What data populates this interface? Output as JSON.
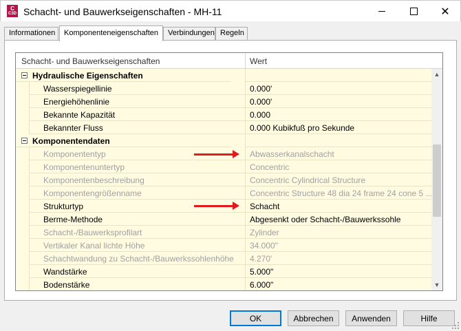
{
  "window": {
    "title": "Schacht- und Bauwerkseigenschaften - MH-11",
    "app_icon": {
      "letter": "C",
      "sub": "C3D",
      "color": "#b3154b"
    },
    "controls": {
      "minimize": "minimize-icon",
      "maximize": "maximize-icon",
      "close": "✕"
    }
  },
  "tabs": [
    {
      "label": "Informationen",
      "active": false
    },
    {
      "label": "Komponenteneigenschaften",
      "active": true
    },
    {
      "label": "Verbindungen",
      "active": false
    },
    {
      "label": "Regeln",
      "active": false
    }
  ],
  "grid": {
    "header": {
      "property": "Schacht- und Bauwerkseigenschaften",
      "value": "Wert"
    },
    "groups": [
      {
        "label": "Hydraulische Eigenschaften",
        "rows": [
          {
            "property": "Wasserspiegellinie",
            "value": "0.000'",
            "enabled": true
          },
          {
            "property": "Energiehöhenlinie",
            "value": "0.000'",
            "enabled": true
          },
          {
            "property": "Bekannte Kapazität",
            "value": "0.000",
            "enabled": true
          },
          {
            "property": "Bekannter Fluss",
            "value": "0.000 Kubikfuß pro Sekunde",
            "enabled": true
          }
        ]
      },
      {
        "label": "Komponentendaten",
        "rows": [
          {
            "property": "Komponententyp",
            "value": "Abwasserkanalschacht",
            "enabled": false
          },
          {
            "property": "Komponentenuntertyp",
            "value": "Concentric",
            "enabled": false
          },
          {
            "property": "Komponentenbeschreibung",
            "value": "Concentric Cylindrical Structure",
            "enabled": false
          },
          {
            "property": "Komponentengrößenname",
            "value": "Concentric Structure 48 dia 24 frame 24 cone 5 ...",
            "enabled": false
          },
          {
            "property": "Strukturtyp",
            "value": "Schacht",
            "enabled": true
          },
          {
            "property": "Berme-Methode",
            "value": "Abgesenkt oder Schacht-/Bauwerkssohle",
            "enabled": true
          },
          {
            "property": "Schacht-/Bauwerksprofilart",
            "value": "Zylinder",
            "enabled": false
          },
          {
            "property": "Vertikaler Kanal lichte Höhe",
            "value": "34.000\"",
            "enabled": false
          },
          {
            "property": "Schachtwandung zu Schacht-/Bauwerkssohlenhöhe",
            "value": "4.270'",
            "enabled": false
          },
          {
            "property": "Wandstärke",
            "value": "5.000\"",
            "enabled": true
          },
          {
            "property": "Bodenstärke",
            "value": "6.000\"",
            "enabled": true
          }
        ]
      }
    ],
    "scrollbar": {
      "up": "▲",
      "down": "▼"
    }
  },
  "annotations": {
    "arrow_color": "#e11b1b"
  },
  "buttons": {
    "ok": "OK",
    "cancel": "Abbrechen",
    "apply": "Anwenden",
    "help": "Hilfe"
  }
}
